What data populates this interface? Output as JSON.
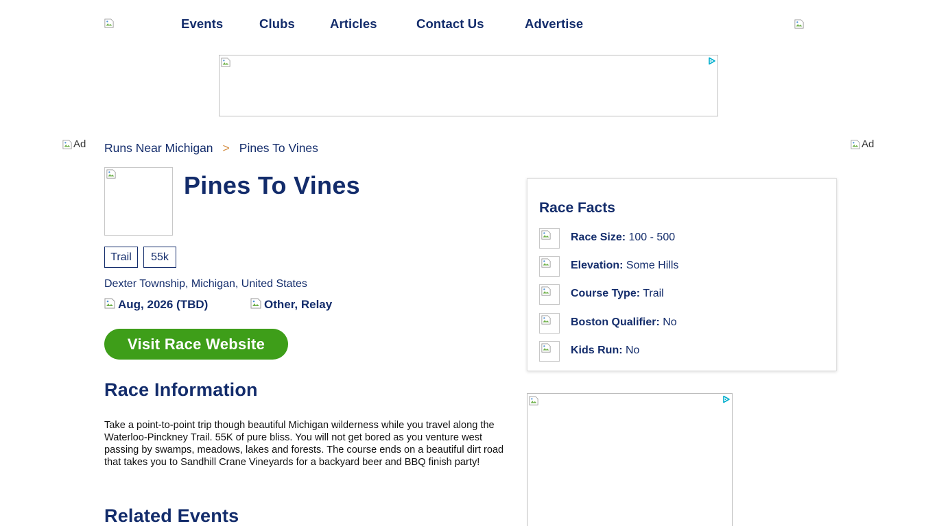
{
  "nav": {
    "items": [
      "Events",
      "Clubs",
      "Articles",
      "Contact Us",
      "Advertise"
    ]
  },
  "side_ads": {
    "left_alt": "Ad",
    "right_alt": "Ad"
  },
  "breadcrumb": {
    "parent": "Runs Near Michigan",
    "separator": ">",
    "current": "Pines To Vines"
  },
  "race": {
    "title": "Pines To Vines",
    "tags": [
      "Trail",
      "55k"
    ],
    "location": "Dexter Township, Michigan, United States",
    "date": "Aug, 2026 (TBD)",
    "category": "Other, Relay",
    "visit_label": "Visit Race Website"
  },
  "race_information": {
    "heading": "Race Information",
    "text": "Take a point-to-point trip though beautiful Michigan wilderness while you travel along the Waterloo-Pinckney Trail. 55K of pure bliss. You will not get bored as you venture west passing by swamps, meadows, lakes and forests. The course ends on a beautiful dirt road that takes you to Sandhill Crane Vineyards for a backyard beer and BBQ finish party!"
  },
  "related_events": {
    "heading": "Related Events"
  },
  "race_facts": {
    "heading": "Race Facts",
    "items": [
      {
        "label": "Race Size:",
        "value": "100 - 500"
      },
      {
        "label": "Elevation:",
        "value": "Some Hills"
      },
      {
        "label": "Course Type:",
        "value": "Trail"
      },
      {
        "label": "Boston Qualifier:",
        "value": "No"
      },
      {
        "label": "Kids Run:",
        "value": "No"
      }
    ]
  },
  "colors": {
    "brand_navy": "#132c6b",
    "accent_green": "#3e9e19",
    "breadcrumb_separator": "#d28a3c",
    "adchoices_blue": "#00aecd"
  }
}
